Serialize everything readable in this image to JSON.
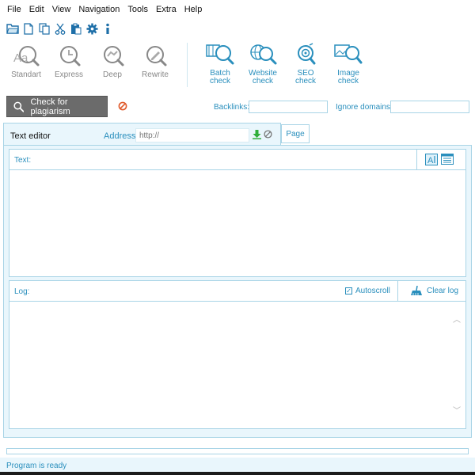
{
  "menu": [
    "File",
    "Edit",
    "View",
    "Navigation",
    "Tools",
    "Extra",
    "Help"
  ],
  "quickbar": [
    "open-folder-icon",
    "new-file-icon",
    "copy-icon",
    "cut-icon",
    "paste-icon",
    "settings-gear-icon",
    "info-icon"
  ],
  "ribbon": {
    "modes": [
      {
        "label": "Standart",
        "icon": "standart-mode-icon"
      },
      {
        "label": "Express",
        "icon": "express-mode-icon"
      },
      {
        "label": "Deep",
        "icon": "deep-mode-icon"
      },
      {
        "label": "Rewrite",
        "icon": "rewrite-mode-icon"
      }
    ],
    "checks": [
      {
        "label_line1": "Batch",
        "label_line2": "check",
        "icon": "batch-check-icon"
      },
      {
        "label_line1": "Website",
        "label_line2": "check",
        "icon": "website-check-icon"
      },
      {
        "label_line1": "SEO",
        "label_line2": "check",
        "icon": "seo-check-icon"
      },
      {
        "label_line1": "Image",
        "label_line2": "check",
        "icon": "image-check-icon"
      }
    ]
  },
  "check_row": {
    "button_label": "Check for plagiarism",
    "backlinks_label": "Backlinks:",
    "backlinks_value": "",
    "ignore_label": "Ignore domains:",
    "ignore_value": ""
  },
  "tabs": {
    "text_editor": "Text editor",
    "address_label": "Address:",
    "address_value": "",
    "address_placeholder": "http://",
    "page": "Page"
  },
  "text_panel": {
    "label": "Text:"
  },
  "log_panel": {
    "label": "Log:",
    "autoscroll_label": "Autoscroll",
    "autoscroll_checked": true,
    "clear_label": "Clear log"
  },
  "progress": {
    "fraction": 0
  },
  "status": {
    "text": "Program is ready"
  },
  "colors": {
    "accent": "#2a8fbd",
    "panel_bg": "#e9f6fc",
    "border": "#a8d4e6",
    "button_gray": "#6b6b6b",
    "stop_red": "#e05a2b",
    "download_green": "#2fae3a"
  }
}
